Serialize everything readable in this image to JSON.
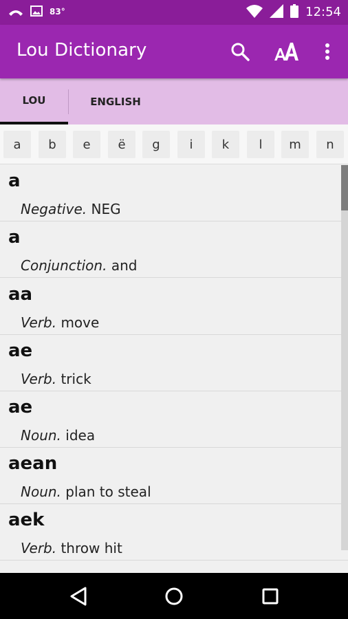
{
  "status_bar": {
    "temperature": "83°",
    "time": "12:54"
  },
  "app_bar": {
    "title": "Lou Dictionary"
  },
  "tabs": [
    {
      "label": "LOU",
      "selected": true
    },
    {
      "label": "ENGLISH",
      "selected": false
    }
  ],
  "alphabet": [
    "a",
    "b",
    "e",
    "ë",
    "g",
    "i",
    "k",
    "l",
    "m",
    "n"
  ],
  "entries": [
    {
      "word": "a",
      "pos": "Negative.",
      "gloss": "NEG"
    },
    {
      "word": "a",
      "pos": "Conjunction.",
      "gloss": "and"
    },
    {
      "word": "aa",
      "pos": "Verb.",
      "gloss": "move"
    },
    {
      "word": "ae",
      "pos": "Verb.",
      "gloss": "trick"
    },
    {
      "word": "ae",
      "pos": "Noun.",
      "gloss": "idea"
    },
    {
      "word": "aean",
      "pos": "Noun.",
      "gloss": "plan to steal"
    },
    {
      "word": "aek",
      "pos": "Verb.",
      "gloss": "throw hit"
    }
  ],
  "colors": {
    "status_bar": "#8a1d99",
    "app_bar": "#9b27b0",
    "tab_bar": "#e2bce6",
    "tab_indicator": "#111111"
  },
  "icons": {
    "status": [
      "missed-call-icon",
      "image-icon",
      "wifi-icon",
      "signal-icon",
      "battery-icon"
    ],
    "actions": [
      "search-icon",
      "font-size-icon",
      "more-vert-icon"
    ],
    "nav": [
      "back-icon",
      "home-icon",
      "recents-icon"
    ]
  }
}
